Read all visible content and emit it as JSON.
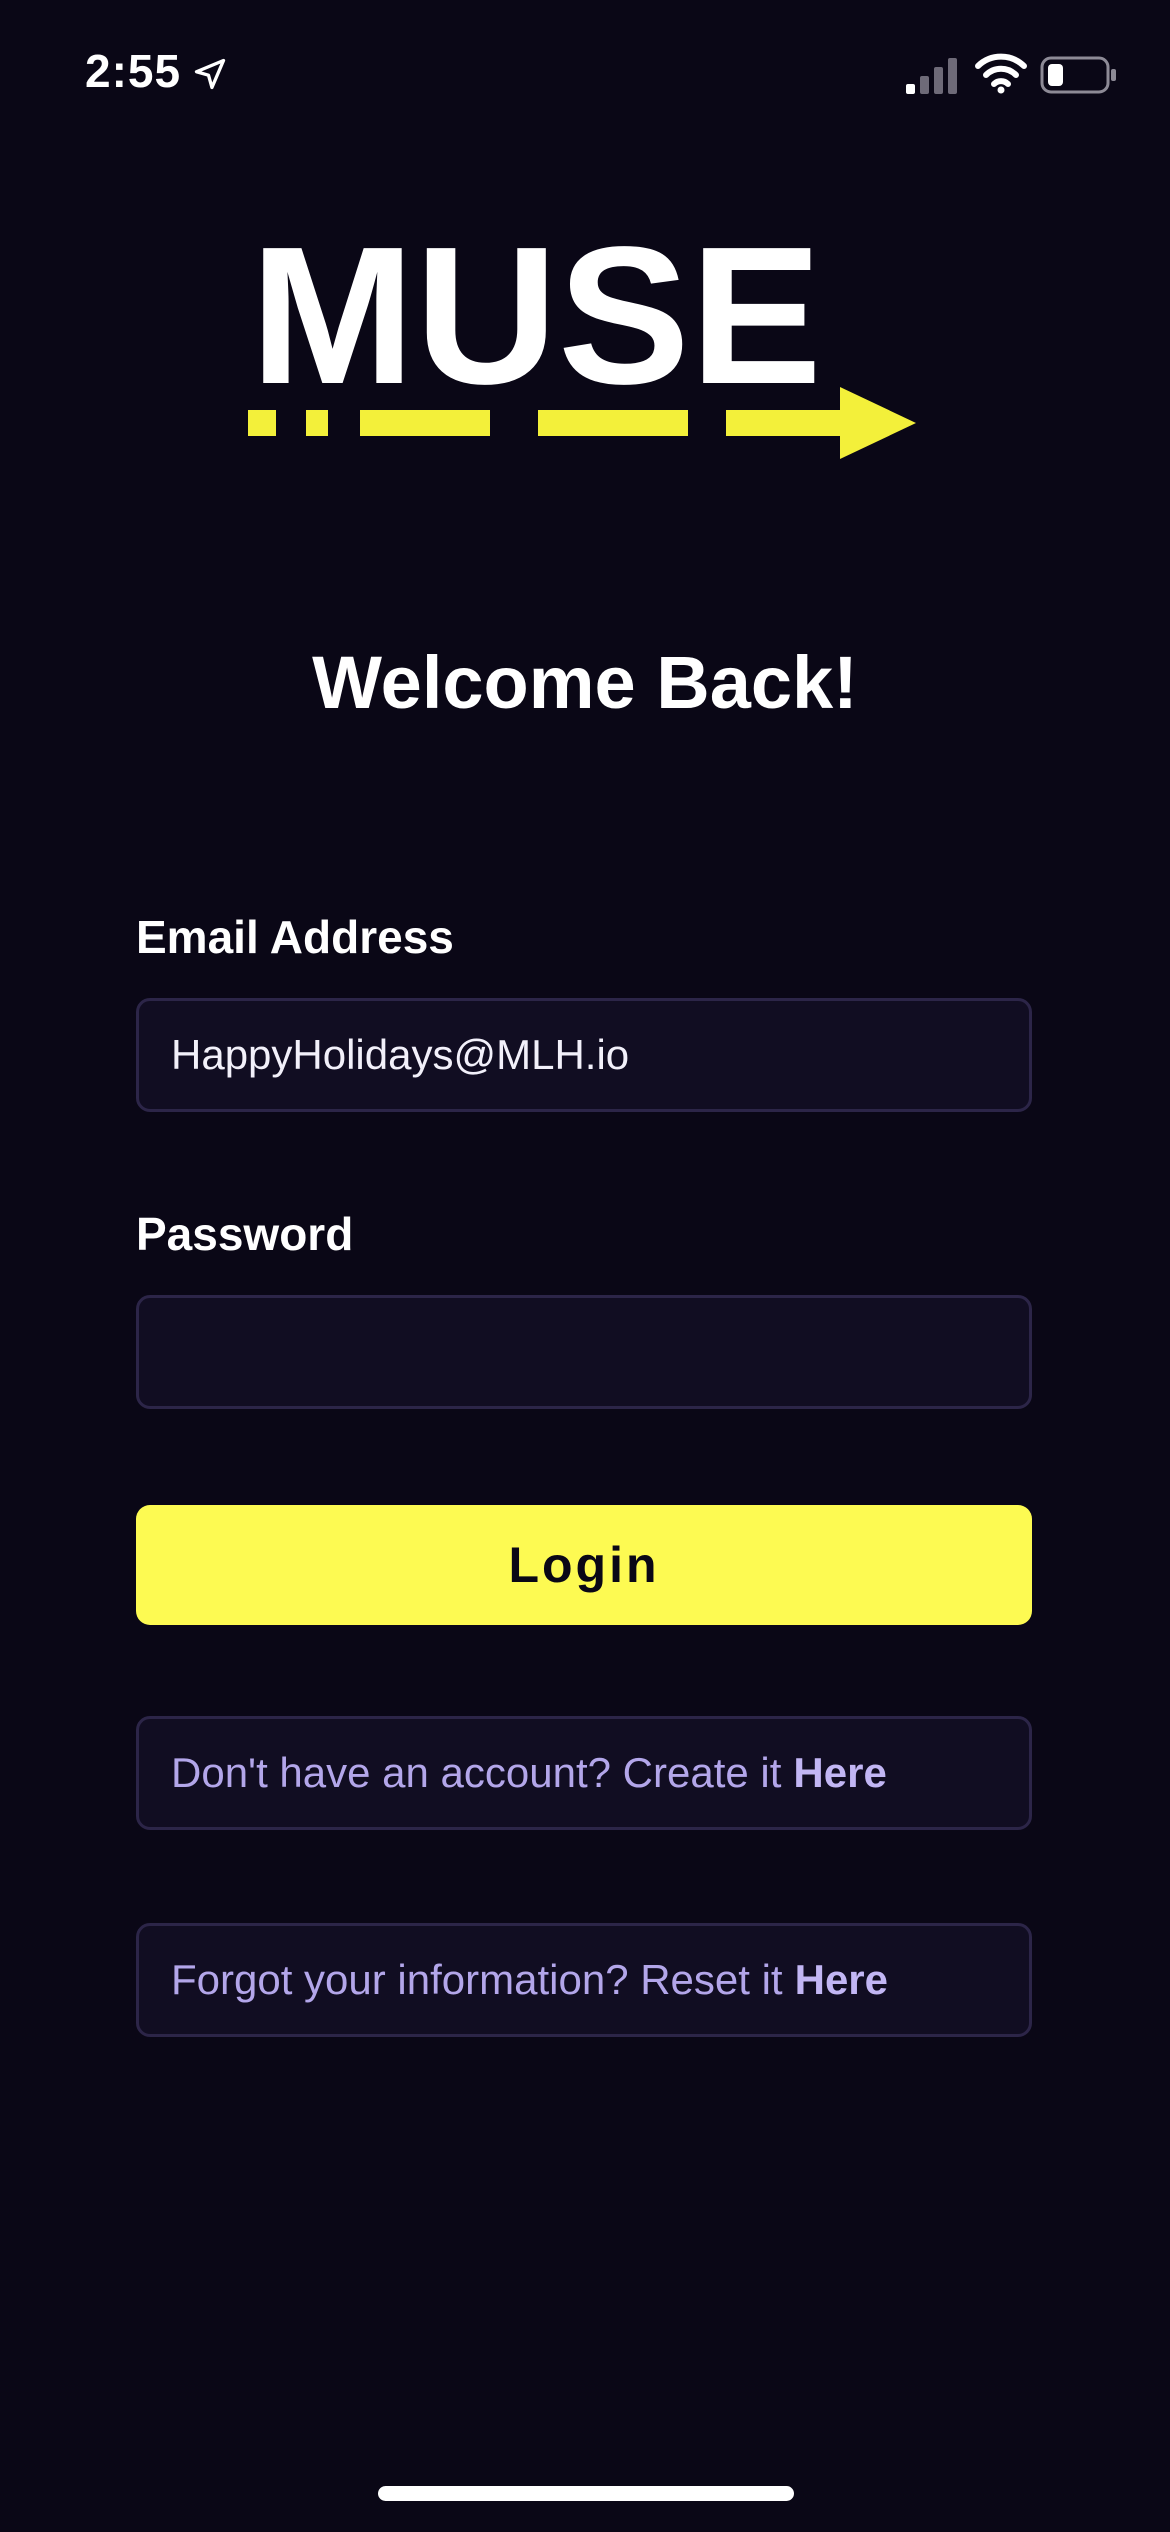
{
  "status_bar": {
    "time": "2:55",
    "icons": [
      "location-arrow-icon",
      "cellular-signal-icon",
      "wifi-icon",
      "battery-icon"
    ]
  },
  "logo": {
    "text": "MUSE",
    "colors": {
      "letters": "#ffffff",
      "arrow": "#f3f03a"
    }
  },
  "welcome": {
    "title": "Welcome Back!"
  },
  "form": {
    "email_label": "Email Address",
    "email_value": "HappyHolidays@MLH.io",
    "password_label": "Password",
    "password_value": "",
    "login_label": "Login"
  },
  "links": {
    "create_text": "Don't have an account? Create it",
    "create_link": "Here",
    "reset_text": "Forgot your information? Reset it",
    "reset_link": "Here"
  },
  "colors": {
    "background": "#0a0716",
    "accent": "#fdfa52",
    "field_background": "#110d22",
    "field_border": "#2c2548",
    "link_text": "#b3a6ea"
  }
}
